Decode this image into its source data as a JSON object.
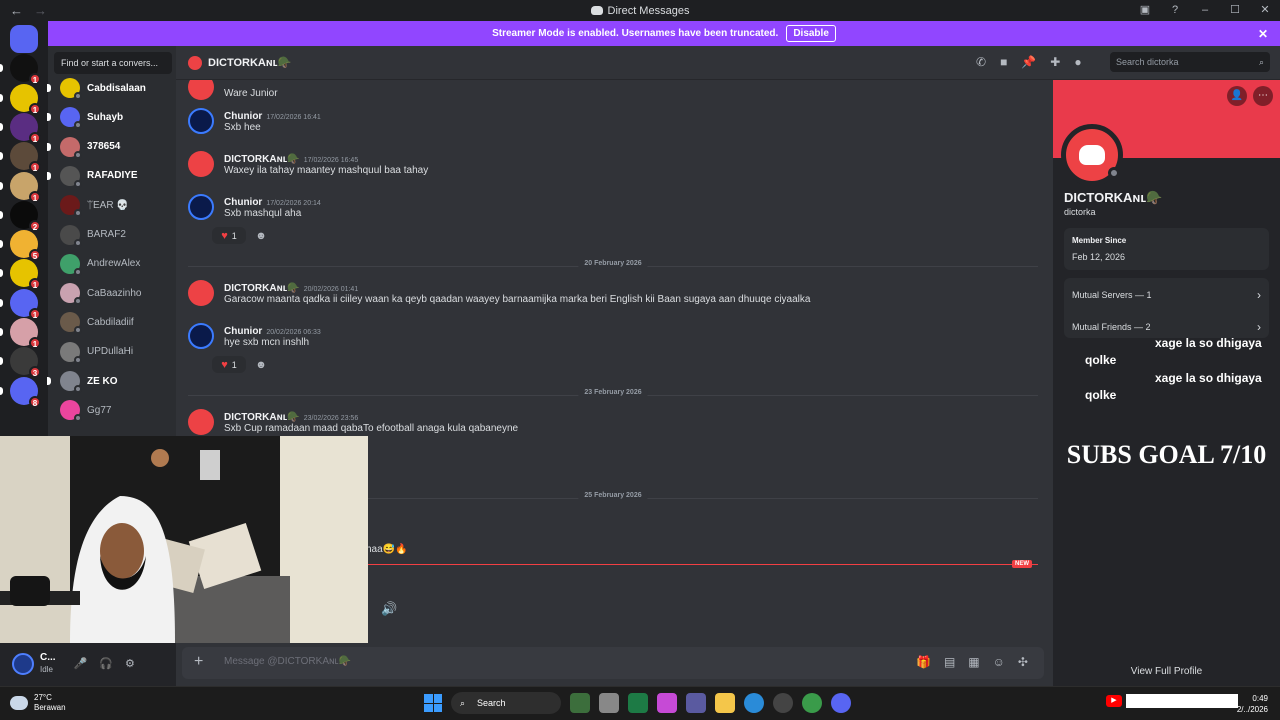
{
  "window": {
    "title": "Direct Messages",
    "nav_back": "←",
    "nav_forward": "→",
    "help": "?",
    "minimize": "–",
    "maximize": "☐",
    "close": "✕"
  },
  "banner": {
    "text": "Streamer Mode is enabled. Usernames have been truncated.",
    "disable_label": "Disable",
    "close": "✕"
  },
  "servers": [
    {
      "color": "#5865f2",
      "badge": "",
      "active": true
    },
    {
      "color": "#111111",
      "badge": "1"
    },
    {
      "color": "#e6c300",
      "badge": "1"
    },
    {
      "color": "#5a2d82",
      "badge": "1"
    },
    {
      "color": "#5c4a3a",
      "badge": "1"
    },
    {
      "color": "#c8a46a",
      "badge": "1"
    },
    {
      "color": "#0b0b0b",
      "badge": "2"
    },
    {
      "color": "#f0b232",
      "badge": "5"
    },
    {
      "color": "#e6c300",
      "badge": "1"
    },
    {
      "color": "#5865f2",
      "badge": "1"
    },
    {
      "color": "#d6a0a8",
      "badge": "1"
    },
    {
      "color": "#3a3a3a",
      "badge": "3"
    },
    {
      "color": "#5865f2",
      "badge": "8"
    }
  ],
  "dm_list": {
    "search_placeholder": "Find or start a convers...",
    "items": [
      {
        "name": "Cabdisalaan",
        "color": "#e6c300",
        "unread": true
      },
      {
        "name": "Suhayb",
        "color": "#5865f2",
        "unread": true
      },
      {
        "name": "378654",
        "color": "#c46a6a",
        "unread": true
      },
      {
        "name": "RAFADIYE",
        "color": "#555555",
        "unread": true
      },
      {
        "name": "ᛠEAR 💀",
        "color": "#6b1a1a",
        "unread": false
      },
      {
        "name": "BARAF2",
        "color": "#4a4a4a",
        "unread": false
      },
      {
        "name": "AndrewAlex",
        "color": "#3fa06a",
        "unread": false
      },
      {
        "name": "CaBaazinho",
        "color": "#c9a2b0",
        "unread": false
      },
      {
        "name": "Cabdiladiif",
        "color": "#6a5a4a",
        "unread": false
      },
      {
        "name": "UPDullaHi",
        "color": "#7a7a7a",
        "unread": false
      },
      {
        "name": "ZE KO",
        "color": "#80848e",
        "unread": true
      },
      {
        "name": "Gg77",
        "color": "#eb459e",
        "unread": false
      }
    ]
  },
  "user_panel": {
    "name": "C...",
    "status": "Idle",
    "mic_icon": "🎤",
    "headset_icon": "🎧",
    "settings_icon": "⚙"
  },
  "chat_header": {
    "name": "DICTORKAɴʟ🪖",
    "search_placeholder": "Search dictorka",
    "search_icon": "⌕"
  },
  "messages": [
    {
      "author": "",
      "time": "",
      "text": "Ware Junior",
      "avatar": "discord-red"
    },
    {
      "author": "Chunior",
      "time": "17/02/2026 16:41",
      "text": "Sxb hee",
      "avatar": "chunior"
    },
    {
      "author": "DICTORKAɴʟ🪖",
      "time": "17/02/2026 16:45",
      "text": "Waxey ila tahay maantey mashquul baa tahay",
      "avatar": "discord-red"
    },
    {
      "author": "Chunior",
      "time": "17/02/2026 20:14",
      "text": "Sxb mashqul aha",
      "avatar": "chunior"
    },
    {
      "author": "DICTORKAɴʟ🪖",
      "time": "20/02/2026 01:41",
      "text": "Garacow maanta qadka ii ciiley waan ka qeyb qaadan waayey barnaamijka marka beri English kii Baan sugaya aan dhuuqe ciyaalka",
      "avatar": "discord-red"
    },
    {
      "author": "Chunior",
      "time": "20/02/2026 06:33",
      "text": "hye sxb mcn inshlh",
      "avatar": "chunior"
    },
    {
      "author": "DICTORKAɴʟ🪖",
      "time": "23/02/2026 23:56",
      "text": "Sxb Cup ramadaan maad qabaTo efootball anaga kula qabaneyne",
      "avatar": "discord-red"
    }
  ],
  "reactions": [
    {
      "emoji": "♥",
      "count": "1"
    },
    {
      "emoji": "♥",
      "count": "1"
    }
  ],
  "dividers": [
    "20 February 2026",
    "23 February 2026",
    "25 February 2026"
  ],
  "partial_message": "haa😅🔥",
  "new_tag": "NEW",
  "composer": {
    "placeholder": "Message @DICTORKAɴʟ🪖",
    "plus": "+"
  },
  "profile": {
    "name": "DICTORKAɴʟ🪖",
    "username": "dictorka",
    "member_since_label": "Member Since",
    "member_since": "Feb 12, 2026",
    "mutual_servers": "Mutual Servers — 1",
    "mutual_friends": "Mutual Friends — 2",
    "view_full": "View Full Profile"
  },
  "overlay": {
    "chat_lines": [
      {
        "who": "",
        "text": "xage la so dhigaya qolke"
      },
      {
        "who": "",
        "text": "xage la so dhigaya qolke"
      }
    ],
    "subs_goal": "SUBS GOAL 7/10"
  },
  "taskbar": {
    "temp": "27°C",
    "weather": "Berawan",
    "search": "Search",
    "time": "0:49",
    "date": "2/../2026"
  }
}
